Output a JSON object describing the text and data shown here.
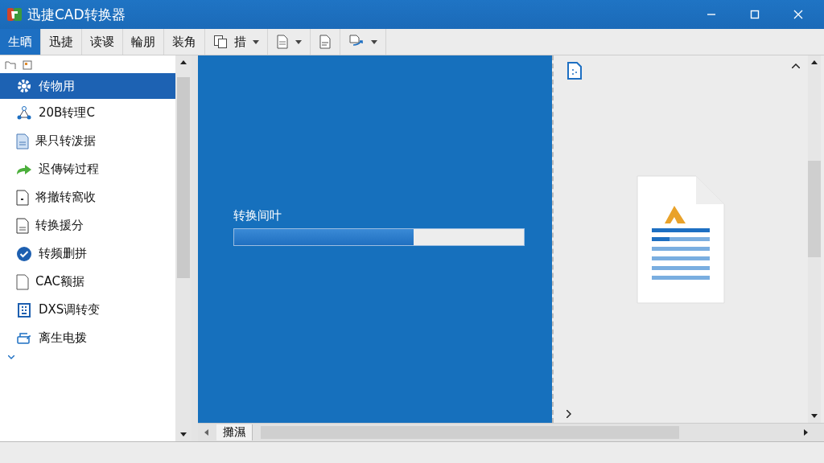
{
  "window": {
    "title": "迅捷CAD转换器"
  },
  "menu": [
    {
      "label": "生晒",
      "selected": true
    },
    {
      "label": "迅捷",
      "selected": false
    },
    {
      "label": "读谡",
      "selected": false
    },
    {
      "label": "輪朋",
      "selected": false
    },
    {
      "label": "装角",
      "selected": false
    }
  ],
  "toolbar": [
    {
      "kind": "copy",
      "label": "措",
      "dropdown": true
    },
    {
      "kind": "doc",
      "dropdown": true
    },
    {
      "kind": "page",
      "dropdown": false
    },
    {
      "kind": "export",
      "dropdown": true
    }
  ],
  "sidebar": {
    "items": [
      {
        "kind": "gear",
        "label": "传物用",
        "selected": true
      },
      {
        "kind": "nodes",
        "label": "20B转理C",
        "selected": false
      },
      {
        "kind": "doc",
        "label": "果只转泼据",
        "selected": false
      },
      {
        "kind": "arrow",
        "label": "迟傳铸过程",
        "selected": false
      },
      {
        "kind": "page",
        "label": "将撤转窩收",
        "selected": false
      },
      {
        "kind": "grid",
        "label": "转换援分",
        "selected": false
      },
      {
        "kind": "check",
        "label": "转频删拼",
        "selected": false
      },
      {
        "kind": "blank",
        "label": "CAC额据",
        "selected": false
      },
      {
        "kind": "frame",
        "label": "DXS调转变",
        "selected": false
      },
      {
        "kind": "printer",
        "label": "离生电拨",
        "selected": false
      }
    ]
  },
  "progress": {
    "label": "转换间叶",
    "level": 0.62
  },
  "bottom_tab": {
    "label": "攤濕"
  }
}
